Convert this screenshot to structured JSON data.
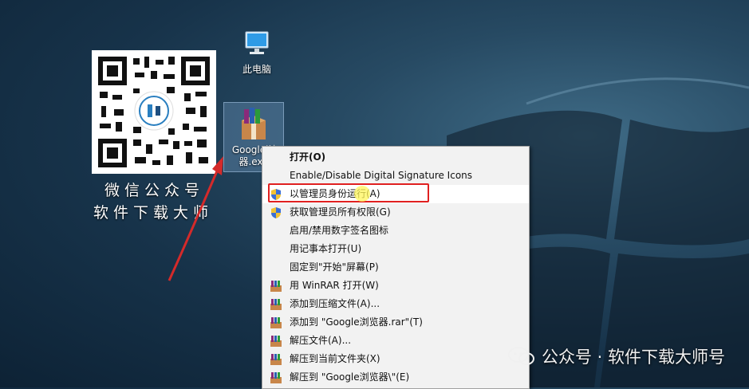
{
  "desktop": {
    "icons": [
      {
        "label": "此电脑",
        "icon": "computer-icon"
      },
      {
        "label": "Google浏览器.exe",
        "icon": "winrar-archive-icon"
      }
    ],
    "exe_label_line1": "Google浏",
    "exe_label_line2": "器.exe",
    "qr_caption_line1": "微信公众号",
    "qr_caption_line2": "软件下载大师",
    "watermark": "公众号 · 软件下载大师号"
  },
  "context_menu": {
    "items": [
      {
        "label": "打开(O)",
        "icon": null,
        "bold": true
      },
      {
        "label": "Enable/Disable Digital Signature Icons",
        "icon": null
      },
      {
        "label": "以管理员身份运行(A)",
        "icon": "uac-shield-icon",
        "highlighted": true
      },
      {
        "label": "获取管理员所有权限(G)",
        "icon": "uac-shield-icon"
      },
      {
        "label": "启用/禁用数字签名图标",
        "icon": null
      },
      {
        "label": "用记事本打开(U)",
        "icon": null
      },
      {
        "label": "固定到\"开始\"屏幕(P)",
        "icon": null
      },
      {
        "label": "用 WinRAR 打开(W)",
        "icon": "winrar-icon"
      },
      {
        "label": "添加到压缩文件(A)...",
        "icon": "winrar-icon"
      },
      {
        "label": "添加到 \"Google浏览器.rar\"(T)",
        "icon": "winrar-icon"
      },
      {
        "label": "解压文件(A)...",
        "icon": "winrar-icon"
      },
      {
        "label": "解压到当前文件夹(X)",
        "icon": "winrar-icon"
      },
      {
        "label": "解压到 \"Google浏览器\\\"(E)",
        "icon": "winrar-icon"
      }
    ]
  },
  "colors": {
    "highlight_border": "#e02020",
    "arrow": "#d42a2a",
    "cursor_glow": "#fff55a"
  }
}
